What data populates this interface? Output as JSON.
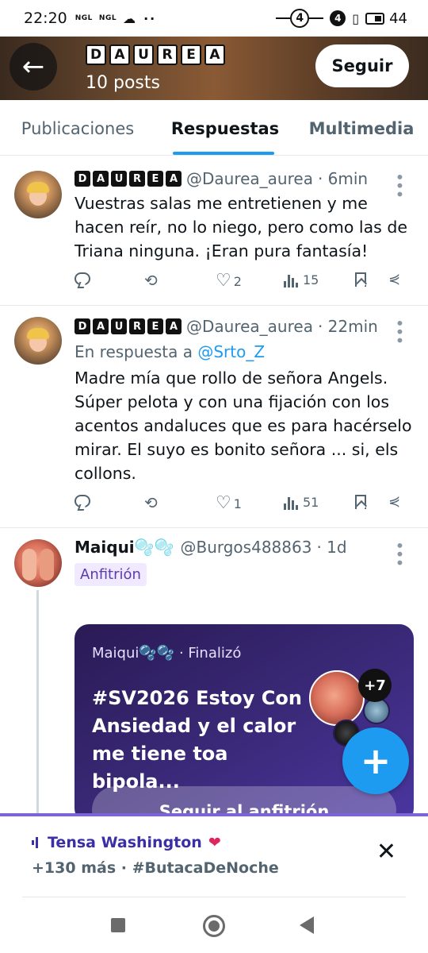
{
  "status_bar": {
    "time": "22:20",
    "tag1": "NGL",
    "tag2": "NGL",
    "dots": "··",
    "network": "4",
    "badge": "4",
    "battery": "44"
  },
  "header": {
    "name_letters": [
      "D",
      "A",
      "U",
      "R",
      "E",
      "A"
    ],
    "posts_count": "10 posts",
    "follow_label": "Seguir",
    "back_icon": "arrow-left-icon"
  },
  "tabs": [
    {
      "label": "Publicaciones",
      "active": false
    },
    {
      "label": "Respuestas",
      "active": true
    },
    {
      "label": "Multimedia",
      "active": false
    }
  ],
  "tweets": [
    {
      "name_letters": [
        "D",
        "A",
        "U",
        "R",
        "E",
        "A"
      ],
      "handle": "@Daurea_aurea",
      "time": "· 6min",
      "text": "Vuestras salas me entretienen y me hacen reír, no lo niego, pero como las de Triana ninguna. ¡Eran pura fantasía!",
      "likes": "2",
      "views": "15"
    },
    {
      "name_letters": [
        "D",
        "A",
        "U",
        "R",
        "E",
        "A"
      ],
      "handle": "@Daurea_aurea",
      "time": "· 22min",
      "reply_prefix": "En respuesta a",
      "reply_to": "@Srto_Z",
      "text": "Madre mía que rollo de señora Angels. Súper pelota y con una fijación con los acentos andaluces que es para hacérselo mirar. El suyo es bonito señora ... si, els collons.",
      "likes": "1",
      "views": "51"
    },
    {
      "name": "Maiqui🫧🫧",
      "handle": "@Burgos488863",
      "time": "· 1d",
      "host_badge": "Anfitrión",
      "space": {
        "meta": "Maiqui🫧🫧 · Finalizó",
        "title": "#SV2026 Estoy Con Ansiedad y el calor me tiene toa bipola...",
        "extra_count": "+7",
        "cta": "Seguir al anfitrión"
      }
    }
  ],
  "live_bar": {
    "host": "Tensa Washington",
    "more": "+130 más · #ButacaDeNoche",
    "close_icon": "close-icon"
  },
  "colors": {
    "accent": "#1d9bf0",
    "space_card": "#3b2a7a",
    "live_bar": "#7b63d8"
  }
}
